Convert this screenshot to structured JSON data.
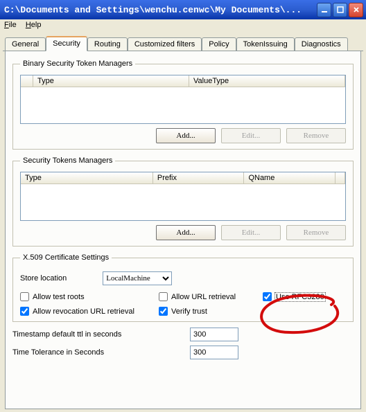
{
  "window": {
    "title": "C:\\Documents and Settings\\wenchu.cenwc\\My Documents\\..."
  },
  "menu": {
    "file": "File",
    "help": "Help"
  },
  "tabs": {
    "general": "General",
    "security": "Security",
    "routing": "Routing",
    "customized": "Customized filters",
    "policy": "Policy",
    "tokenissuing": "TokenIssuing",
    "diagnostics": "Diagnostics"
  },
  "binary_group": {
    "legend": "Binary Security Token Managers",
    "col_type": "Type",
    "col_valuetype": "ValueType",
    "add": "Add...",
    "edit": "Edit...",
    "remove": "Remove"
  },
  "tokens_group": {
    "legend": "Security Tokens Managers",
    "col_type": "Type",
    "col_prefix": "Prefix",
    "col_qname": "QName",
    "add": "Add...",
    "edit": "Edit...",
    "remove": "Remove"
  },
  "x509": {
    "legend": "X.509 Certificate Settings",
    "store_location_label": "Store location",
    "store_location_value": "LocalMachine",
    "allow_test_roots": "Allow test roots",
    "allow_url_retrieval": "Allow URL retrieval",
    "use_rfc3280": "Use RFC3280",
    "allow_rev_url": "Allow revocation URL retrieval",
    "verify_trust": "Verify trust"
  },
  "timestamp": {
    "ttl_label": "Timestamp default ttl in seconds",
    "ttl_value": "300",
    "tolerance_label": "Time Tolerance in Seconds",
    "tolerance_value": "300"
  }
}
